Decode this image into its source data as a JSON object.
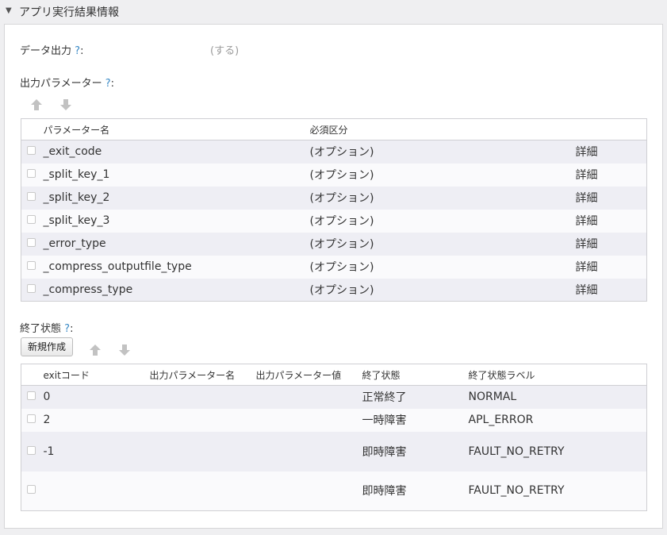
{
  "section": {
    "title": "アプリ実行結果情報"
  },
  "data_output": {
    "label": "データ出力",
    "help": "?",
    "colon": ":",
    "value": "(する)"
  },
  "output_params": {
    "label": "出力パラメーター",
    "help": "?",
    "colon": ":",
    "columns": [
      "パラメーター名",
      "必須区分"
    ],
    "rows": [
      {
        "name": "_exit_code",
        "required": "(オプション)",
        "detail": "詳細"
      },
      {
        "name": "_split_key_1",
        "required": "(オプション)",
        "detail": "詳細"
      },
      {
        "name": "_split_key_2",
        "required": "(オプション)",
        "detail": "詳細"
      },
      {
        "name": "_split_key_3",
        "required": "(オプション)",
        "detail": "詳細"
      },
      {
        "name": "_error_type",
        "required": "(オプション)",
        "detail": "詳細"
      },
      {
        "name": "_compress_outputfile_type",
        "required": "(オプション)",
        "detail": "詳細"
      },
      {
        "name": "_compress_type",
        "required": "(オプション)",
        "detail": "詳細"
      }
    ]
  },
  "exit_status": {
    "label": "終了状態",
    "help": "?",
    "colon": ":",
    "new_button": "新規作成",
    "columns": [
      "exitコード",
      "出力パラメーター名",
      "出力パラメーター値",
      "終了状態",
      "終了状態ラベル"
    ],
    "rows": [
      {
        "code": "0",
        "param_name": "",
        "param_value": "",
        "status": "正常終了",
        "label": "NORMAL"
      },
      {
        "code": "2",
        "param_name": "",
        "param_value": "",
        "status": "一時障害",
        "label": "APL_ERROR"
      },
      {
        "code": "-1",
        "param_name": "",
        "param_value": "",
        "status": "即時障害",
        "label": "FAULT_NO_RETRY"
      },
      {
        "code": "",
        "param_name": "",
        "param_value": "",
        "status": "即時障害",
        "label": "FAULT_NO_RETRY"
      }
    ]
  },
  "icons": {
    "collapse": "triangle-down-icon",
    "up": "arrow-up-icon",
    "down": "arrow-down-icon"
  }
}
